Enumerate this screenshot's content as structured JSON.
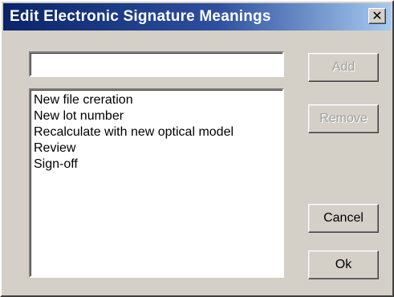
{
  "window": {
    "title": "Edit Electronic Signature Meanings",
    "close_glyph": "✕"
  },
  "input": {
    "value": "",
    "placeholder": ""
  },
  "list": {
    "items": [
      "New file creration",
      "New lot number",
      "Recalculate with new optical model",
      "Review",
      "Sign-off"
    ]
  },
  "buttons": {
    "add": "Add",
    "remove": "Remove",
    "cancel": "Cancel",
    "ok": "Ok"
  },
  "colors": {
    "titlebar_start": "#0a246a",
    "titlebar_end": "#a6caf0",
    "face": "#d4d0c8",
    "disabled_text": "#a0a0a0"
  }
}
